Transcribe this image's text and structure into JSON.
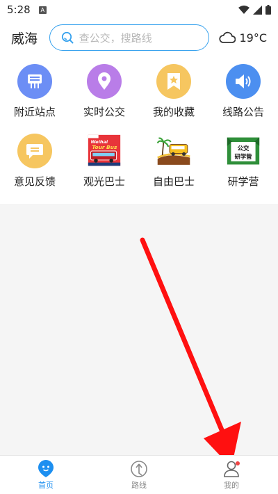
{
  "status_bar": {
    "time": "5:28",
    "notification_letter": "A"
  },
  "header": {
    "city": "威海",
    "search_placeholder": "查公交，搜路线",
    "weather": "19°C"
  },
  "grid": [
    {
      "label": "附近站点",
      "icon": "bus-stop-icon",
      "color": "#6c8ef5"
    },
    {
      "label": "实时公交",
      "icon": "location-pin-icon",
      "color": "#b97de8"
    },
    {
      "label": "我的收藏",
      "icon": "bookmark-star-icon",
      "color": "#f6c660"
    },
    {
      "label": "线路公告",
      "icon": "speaker-icon",
      "color": "#4c8ff0"
    },
    {
      "label": "意见反馈",
      "icon": "feedback-icon",
      "color": "#f6c660"
    },
    {
      "label": "观光巴士",
      "icon": "tour-bus-image",
      "image_text": "Weihai Tour Bus"
    },
    {
      "label": "自由巴士",
      "icon": "free-bus-image"
    },
    {
      "label": "研学营",
      "icon": "study-camp-image",
      "image_text": "公交 研学营"
    }
  ],
  "tabbar": [
    {
      "label": "首页",
      "icon": "home-face-icon",
      "active": true,
      "color": "#1d8ff0"
    },
    {
      "label": "路线",
      "icon": "route-compass-icon",
      "active": false,
      "color": "#888888"
    },
    {
      "label": "我的",
      "icon": "profile-icon",
      "active": false,
      "color": "#888888",
      "badge": true
    }
  ]
}
